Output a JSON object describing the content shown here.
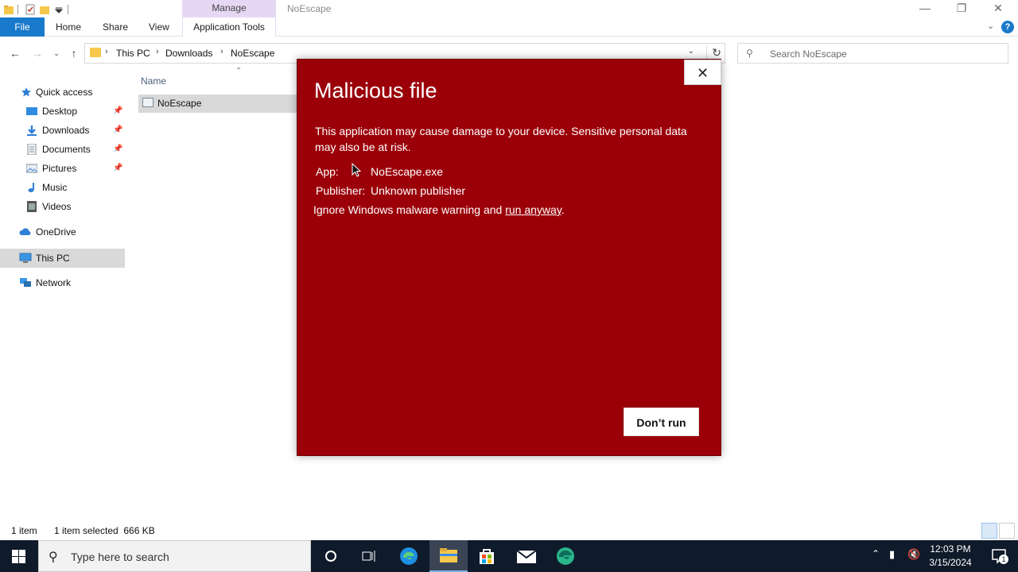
{
  "window": {
    "title": "NoEscape",
    "manage_tab": "Manage",
    "min_icon": "minimize-icon",
    "max_icon": "restore-icon",
    "close_icon": "close-icon"
  },
  "ribbon": {
    "file": "File",
    "home": "Home",
    "share": "Share",
    "view": "View",
    "app_tools": "Application Tools"
  },
  "address": {
    "crumbs": [
      "This PC",
      "Downloads",
      "NoEscape"
    ]
  },
  "search": {
    "placeholder": "Search NoEscape"
  },
  "nav": {
    "quick_access": "Quick access",
    "items": [
      {
        "label": "Desktop",
        "icon": "desktop-icon",
        "pinned": true
      },
      {
        "label": "Downloads",
        "icon": "downloads-icon",
        "pinned": true
      },
      {
        "label": "Documents",
        "icon": "documents-icon",
        "pinned": true
      },
      {
        "label": "Pictures",
        "icon": "pictures-icon",
        "pinned": true
      },
      {
        "label": "Music",
        "icon": "music-icon",
        "pinned": false
      },
      {
        "label": "Videos",
        "icon": "videos-icon",
        "pinned": false
      }
    ],
    "onedrive": "OneDrive",
    "this_pc": "This PC",
    "network": "Network"
  },
  "files": {
    "column_name": "Name",
    "rows": [
      {
        "name": "NoEscape",
        "icon": "application-icon"
      }
    ]
  },
  "status": {
    "count": "1 item",
    "selected": "1 item selected  666 KB"
  },
  "dialog": {
    "title": "Malicious file",
    "message": "This application may cause damage to your device. Sensitive personal data may also be at risk.",
    "app_label": "App:",
    "app_value": "NoEscape.exe",
    "publisher_label": "Publisher:",
    "publisher_value": "Unknown publisher",
    "ignore_prefix": "Ignore Windows malware warning and ",
    "run_anyway": "run anyway",
    "ignore_suffix": ".",
    "dont_run": "Don’t run",
    "background": "#9b0009"
  },
  "taskbar": {
    "search_placeholder": "Type here to search",
    "time": "12:03 PM",
    "date": "3/15/2024",
    "notification_count": "1"
  }
}
